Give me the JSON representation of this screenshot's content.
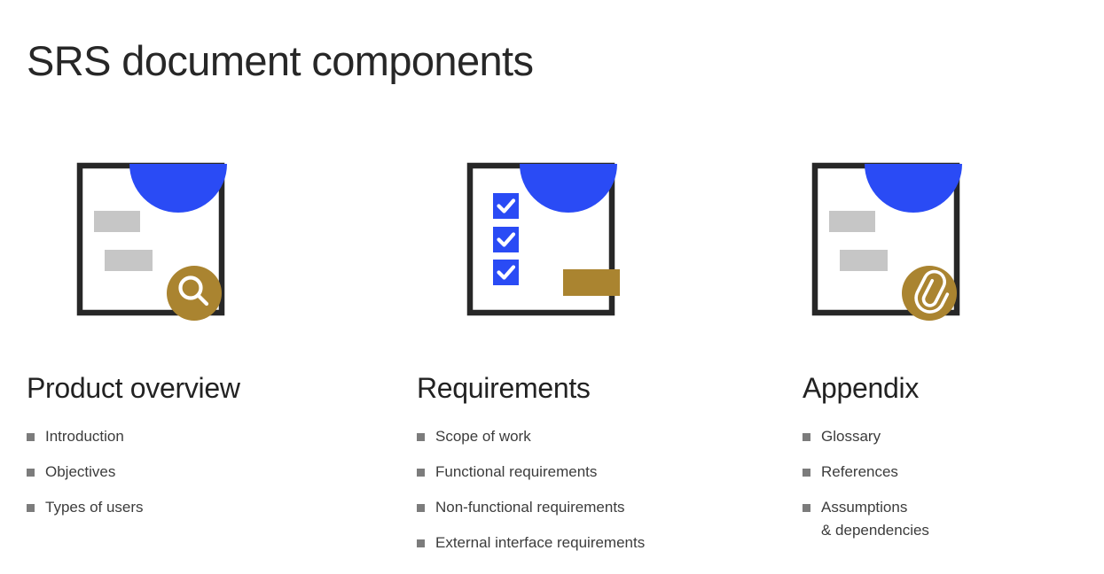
{
  "slide": {
    "title": "SRS document components",
    "background_color": "#ffffff"
  },
  "palette": {
    "blue": "#2A4BF5",
    "gold": "#AA8430",
    "ink": "#272727",
    "gray_bar": "#C6C6C6",
    "bullet": "#7c7c7c",
    "white": "#ffffff"
  },
  "columns": [
    {
      "id": "product-overview",
      "heading": "Product overview",
      "icon": {
        "name": "document-with-magnifier-icon",
        "parts": [
          "document-outline",
          "blue-semicircle",
          "gray-bar",
          "gray-bar",
          "gold-circle-badge",
          "search-icon"
        ]
      },
      "items": [
        {
          "label": "Introduction"
        },
        {
          "label": "Objectives"
        },
        {
          "label": "Types of users"
        }
      ]
    },
    {
      "id": "requirements",
      "heading": "Requirements",
      "icon": {
        "name": "document-with-checkboxes-icon",
        "parts": [
          "document-outline",
          "blue-semicircle",
          "checkbox-checked",
          "checkbox-checked",
          "checkbox-checked",
          "gold-rectangle-badge"
        ]
      },
      "items": [
        {
          "label": "Scope of work"
        },
        {
          "label": "Functional requirements"
        },
        {
          "label": "Non-functional requirements"
        },
        {
          "label": "External interface requirements"
        }
      ]
    },
    {
      "id": "appendix",
      "heading": "Appendix",
      "icon": {
        "name": "document-with-paperclip-icon",
        "parts": [
          "document-outline",
          "blue-semicircle",
          "gray-bar",
          "gray-bar",
          "gold-circle-badge",
          "paperclip-icon"
        ]
      },
      "items": [
        {
          "label": "Glossary"
        },
        {
          "label": "References"
        },
        {
          "label": "Assumptions\n& dependencies"
        }
      ]
    }
  ]
}
